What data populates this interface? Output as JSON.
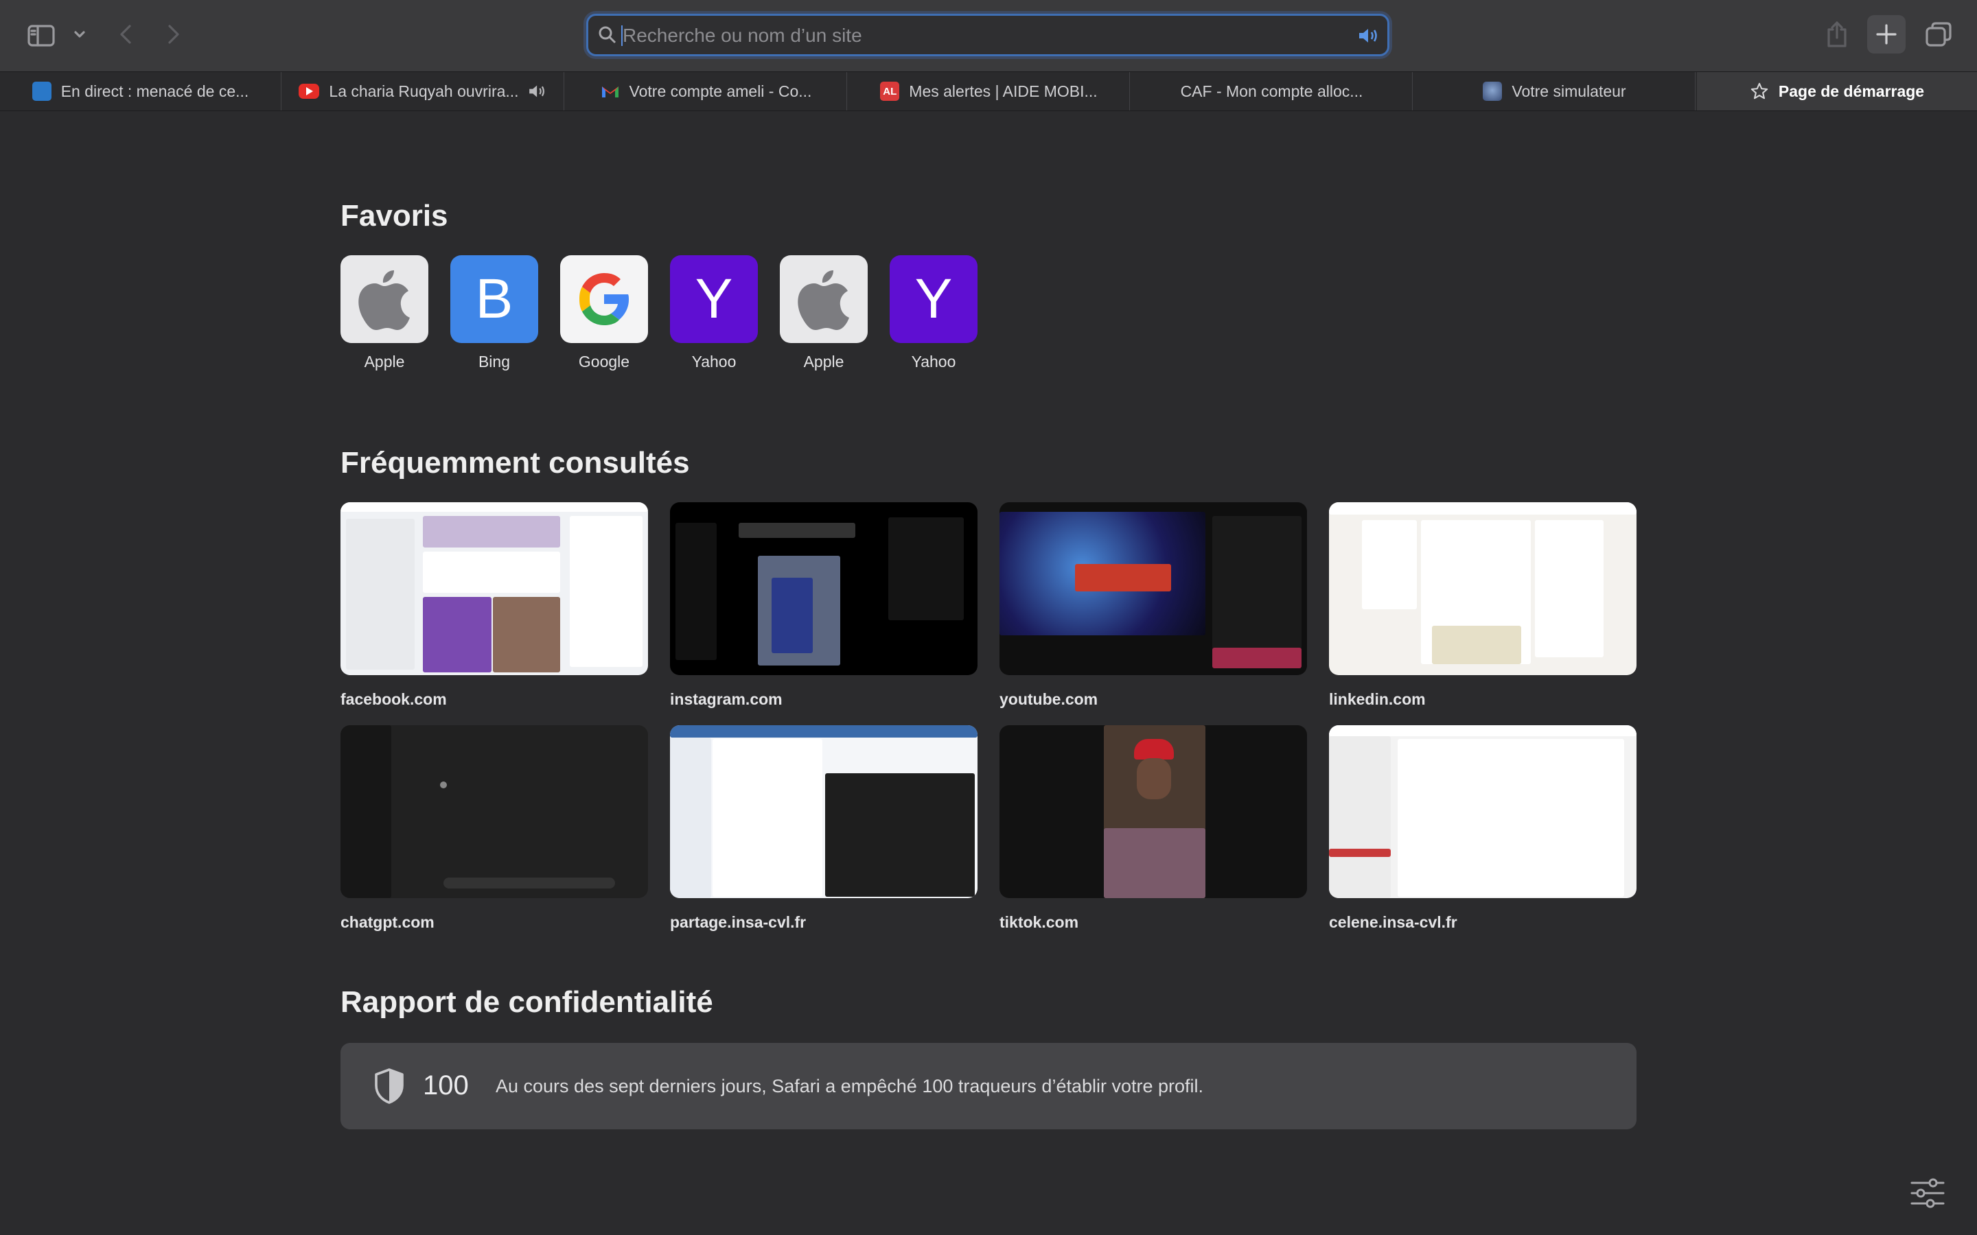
{
  "toolbar": {
    "address_placeholder": "Recherche ou nom d’un site",
    "icons": [
      "sidebar-icon",
      "chevron-down-icon",
      "back-icon",
      "forward-icon",
      "search-icon",
      "audio-icon",
      "share-icon",
      "new-tab-icon",
      "tab-overview-icon"
    ]
  },
  "tabs": [
    {
      "title": "En direct : menacé de ce...",
      "favicon": "france24-icon",
      "color": "#2a78c8"
    },
    {
      "title": "La charia Ruqyah ouvrira...",
      "favicon": "youtube-icon",
      "color": "#e52d27"
    },
    {
      "title": "Votre compte ameli - Co...",
      "favicon": "gmail-icon",
      "color": "#ea4335"
    },
    {
      "title": "Mes alertes | AIDE MOBI...",
      "favicon": "al-icon",
      "color": "#d93a3a"
    },
    {
      "title": "CAF - Mon compte alloc...",
      "favicon": "",
      "color": ""
    },
    {
      "title": "Votre simulateur",
      "favicon": "simulateur-icon",
      "color": "#4a6a9a"
    },
    {
      "title": "Page de démarrage",
      "favicon": "star-icon",
      "active": true
    }
  ],
  "start_page": {
    "favorites_title": "Favoris",
    "favorites": [
      {
        "label": "Apple",
        "icon": "apple-icon",
        "bg": "#e8e8ea"
      },
      {
        "label": "Bing",
        "icon": "B",
        "bg": "#3f86e8"
      },
      {
        "label": "Google",
        "icon": "google-icon",
        "bg": "#f4f4f5"
      },
      {
        "label": "Yahoo",
        "icon": "Y",
        "bg": "#5f0fd2"
      },
      {
        "label": "Apple",
        "icon": "apple-icon",
        "bg": "#e8e8ea"
      },
      {
        "label": "Yahoo",
        "icon": "Y",
        "bg": "#5f0fd2"
      }
    ],
    "frequent_title": "Fréquemment consultés",
    "frequent": [
      {
        "label": "facebook.com",
        "bg": "#f0f2f5"
      },
      {
        "label": "instagram.com",
        "bg": "#000000"
      },
      {
        "label": "youtube.com",
        "bg": "#0f0f0f"
      },
      {
        "label": "linkedin.com",
        "bg": "#f4f2ee"
      },
      {
        "label": "chatgpt.com",
        "bg": "#212121"
      },
      {
        "label": "partage.insa-cvl.fr",
        "bg": "#f4f6f9"
      },
      {
        "label": "tiktok.com",
        "bg": "#121212"
      },
      {
        "label": "celene.insa-cvl.fr",
        "bg": "#f3f3f3"
      }
    ],
    "privacy_title": "Rapport de confidentialité",
    "privacy_count": "100",
    "privacy_text": "Au cours des sept derniers jours, Safari a empêché 100 traqueurs d’établir votre profil."
  }
}
